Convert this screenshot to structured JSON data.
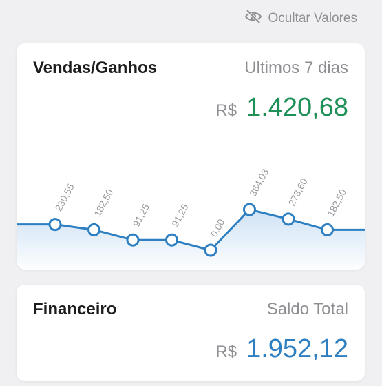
{
  "header": {
    "hide_values_label": "Ocultar Valores",
    "icon": "eye-slash-icon"
  },
  "sales_card": {
    "title": "Vendas/Ganhos",
    "period": "Ultimos 7 dias",
    "currency": "R$",
    "total": "1.420,68"
  },
  "finance_card": {
    "title": "Financeiro",
    "subtitle": "Saldo Total",
    "currency": "R$",
    "total": "1.952,12"
  },
  "colors": {
    "line": "#2d7fc1",
    "fill": "#cfe2f5",
    "green_value": "#1e8f57",
    "blue_value": "#2d7fc1"
  },
  "chart_data": {
    "type": "area",
    "x": [
      1,
      2,
      3,
      4,
      5,
      6,
      7,
      8
    ],
    "values": [
      230.55,
      182.5,
      91.25,
      91.25,
      0.0,
      364.03,
      278.6,
      182.5
    ],
    "labels": [
      "230,55",
      "182,50",
      "91,25",
      "91,25",
      "0,00",
      "364,03",
      "278,60",
      "182,50"
    ],
    "ylim": [
      0,
      364.03
    ],
    "grid": false,
    "legend": "none",
    "extends_to_edges": true
  }
}
